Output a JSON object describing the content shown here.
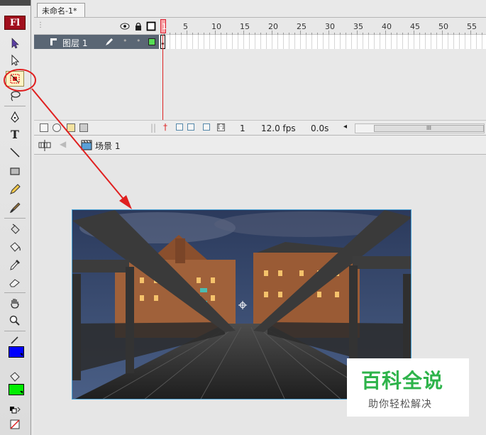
{
  "tab": {
    "title": "未命名-1*"
  },
  "toolbar": {
    "logo": "Fl",
    "tools": [
      "selection-tool",
      "subselection-tool",
      "free-transform-tool",
      "lasso-tool",
      "pen-tool",
      "text-tool",
      "line-tool",
      "rectangle-tool",
      "pencil-tool",
      "brush-tool",
      "ink-bottle-tool",
      "paint-bucket-tool",
      "eyedropper-tool",
      "eraser-tool",
      "hand-tool",
      "zoom-tool"
    ],
    "stroke_color": "#0000ff",
    "fill_color": "#00ee00"
  },
  "timeline": {
    "frame_numbers": [
      "1",
      "5",
      "10",
      "15",
      "20",
      "25",
      "30",
      "35",
      "40",
      "45",
      "50",
      "55"
    ],
    "layer_name": "图层 1",
    "layer_color": "#55dd55",
    "current_frame": "1",
    "frame_rate": "12.0 fps",
    "time": "0.0s",
    "scroll_thumb": "III"
  },
  "editbar": {
    "scene": "场景 1"
  },
  "watermark": {
    "title": "百科全说",
    "subtitle": "助你轻松解决"
  },
  "annotation": {
    "color": "#e02020"
  }
}
